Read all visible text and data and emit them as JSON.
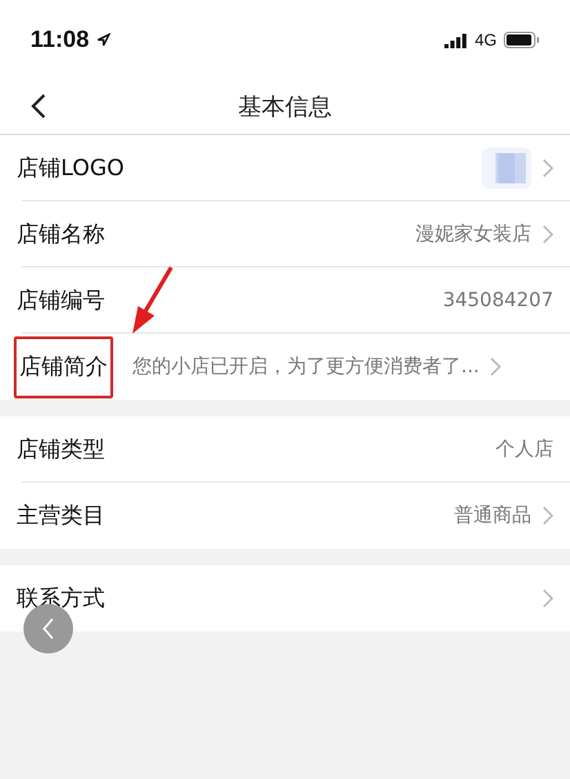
{
  "status_bar": {
    "time": "11:08",
    "network": "4G"
  },
  "nav": {
    "title": "基本信息"
  },
  "sections": [
    [
      {
        "kind": "logo",
        "label": "店铺LOGO",
        "chevron": true,
        "highlighted": false
      },
      {
        "kind": "text",
        "label": "店铺名称",
        "value": "漫妮家女装店",
        "chevron": true,
        "highlighted": false
      },
      {
        "kind": "text",
        "label": "店铺编号",
        "value": "345084207",
        "chevron": false,
        "highlighted": false
      },
      {
        "kind": "text",
        "label": "店铺简介",
        "value": "您的小店已开启，为了更方便消费者了...",
        "chevron": true,
        "highlighted": true
      }
    ],
    [
      {
        "kind": "text",
        "label": "店铺类型",
        "value": "个人店",
        "chevron": false,
        "highlighted": false
      },
      {
        "kind": "text",
        "label": "主营类目",
        "value": "普通商品",
        "chevron": true,
        "highlighted": false
      }
    ],
    [
      {
        "kind": "text",
        "label": "联系方式",
        "chevron": true,
        "highlighted": false
      }
    ]
  ]
}
